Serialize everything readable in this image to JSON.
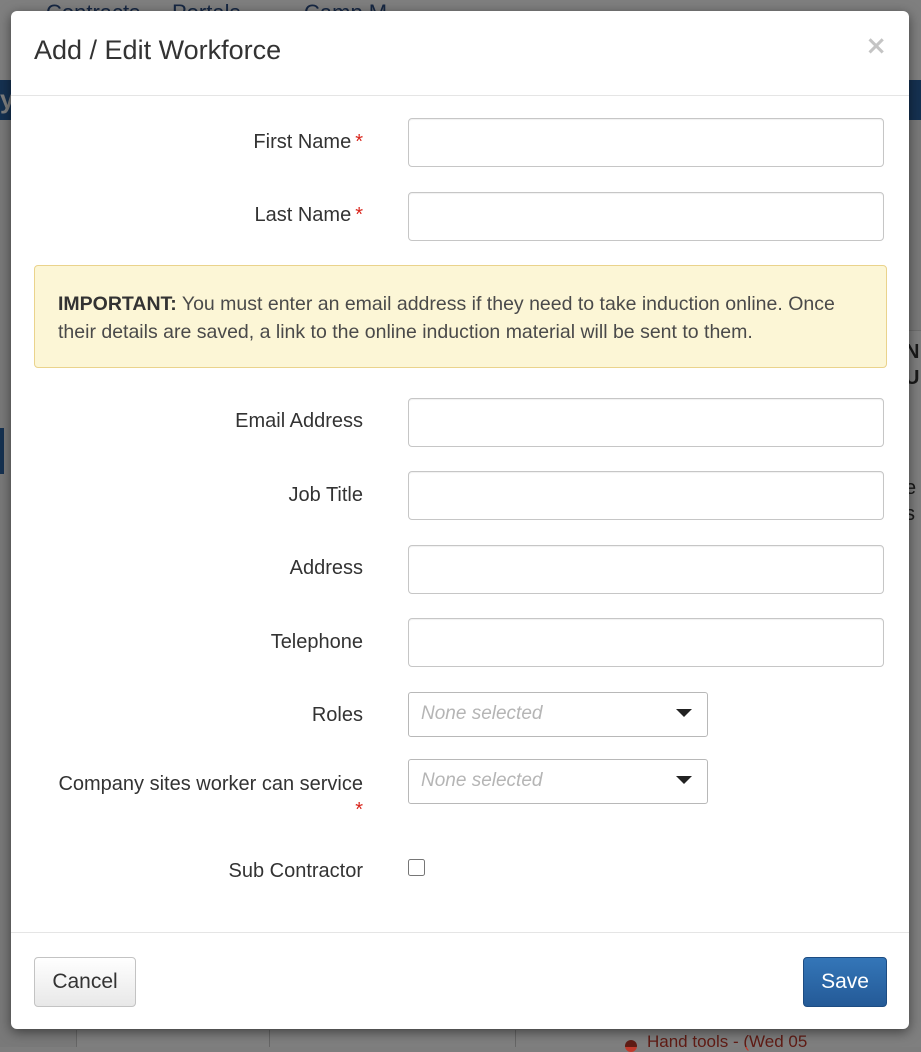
{
  "background": {
    "nav_items": [
      "Contracts",
      "Portals",
      "Camp M"
    ],
    "bar_char": "y",
    "right_column_chars": [
      "N",
      "U",
      "e",
      "s"
    ],
    "bottom_link": "Hand tools - (Wed 05"
  },
  "modal": {
    "title": "Add / Edit Workforce",
    "close_glyph": "×"
  },
  "form": {
    "required_marker": "*",
    "first_name": {
      "label": "First Name",
      "value": ""
    },
    "last_name": {
      "label": "Last Name",
      "value": ""
    },
    "alert": {
      "strong": "IMPORTANT:",
      "text": " You must enter an email address if they need to take induction online. Once their details are saved, a link to the online induction material will be sent to them."
    },
    "email": {
      "label": "Email Address",
      "value": ""
    },
    "job_title": {
      "label": "Job Title",
      "value": ""
    },
    "address": {
      "label": "Address",
      "value": ""
    },
    "telephone": {
      "label": "Telephone",
      "value": ""
    },
    "roles": {
      "label": "Roles",
      "placeholder": "None selected"
    },
    "company_sites": {
      "label": "Company sites worker can service",
      "placeholder": "None selected"
    },
    "sub_contractor": {
      "label": "Sub Contractor",
      "checked": false
    }
  },
  "footer": {
    "cancel_label": "Cancel",
    "save_label": "Save"
  },
  "colors": {
    "primary": "#2a63a3",
    "required": "#d9251c",
    "alert_bg": "#fcf6d6",
    "alert_border": "#ead38c"
  }
}
